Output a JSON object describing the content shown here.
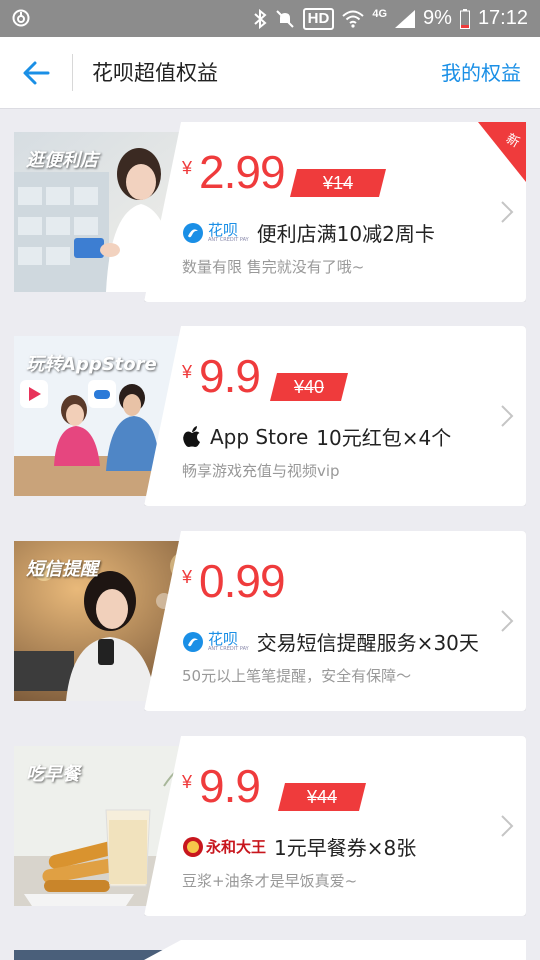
{
  "status_bar": {
    "hd": "HD",
    "network": "4G",
    "battery": "9%",
    "time": "17:12"
  },
  "nav": {
    "title": "花呗超值权益",
    "my_benefits": "我的权益"
  },
  "cards": [
    {
      "banner": "逛便利店",
      "price_symbol": "¥",
      "price": "2.99",
      "original_price": "¥14",
      "brand": "花呗",
      "title": "便利店满10减2周卡",
      "subtitle": "数量有限 售完就没有了哦~",
      "tag": "新"
    },
    {
      "banner": "玩转AppStore",
      "price_symbol": "¥",
      "price": "9.9",
      "original_price": "¥40",
      "brand": "App Store",
      "title": "10元红包×4个",
      "subtitle": "畅享游戏充值与视频vip"
    },
    {
      "banner": "短信提醒",
      "price_symbol": "¥",
      "price": "0.99",
      "brand": "花呗",
      "title": "交易短信提醒服务×30天",
      "subtitle": "50元以上笔笔提醒，安全有保障～"
    },
    {
      "banner": "吃早餐",
      "price_symbol": "¥",
      "price": "9.9",
      "original_price": "¥44",
      "brand": "永和大王",
      "title": "1元早餐券×8张",
      "subtitle": "豆浆+油条才是早饭真爱~"
    }
  ],
  "colors": {
    "accent_blue": "#1a8fe6",
    "price_red": "#ef3b3c",
    "background": "#ececf1"
  }
}
